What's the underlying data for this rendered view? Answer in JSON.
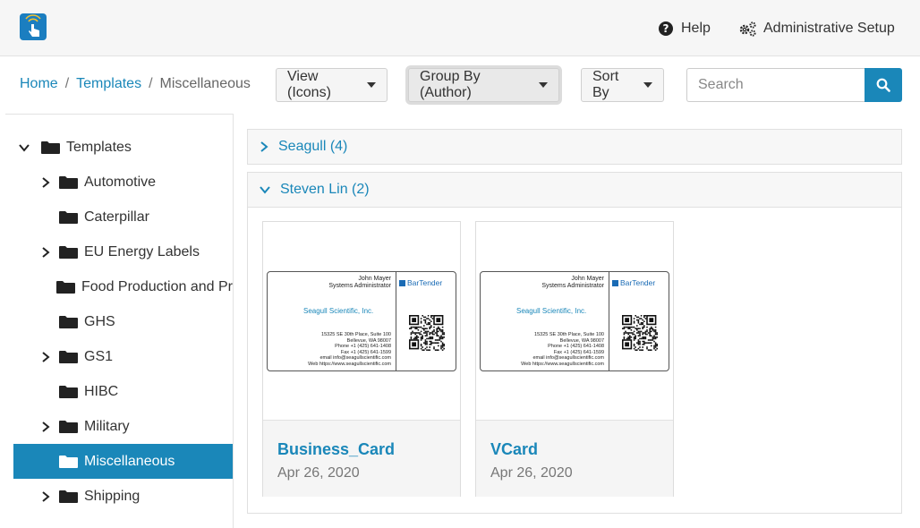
{
  "header": {
    "help_label": "Help",
    "admin_label": "Administrative Setup"
  },
  "breadcrumb": {
    "home": "Home",
    "templates": "Templates",
    "current": "Miscellaneous"
  },
  "toolbar": {
    "view_label": "View (Icons)",
    "group_label": "Group By (Author)",
    "sort_label": "Sort By",
    "search_placeholder": "Search"
  },
  "tree": {
    "root": "Templates",
    "items": [
      {
        "label": "Automotive",
        "expandable": true
      },
      {
        "label": "Caterpillar",
        "expandable": false
      },
      {
        "label": "EU Energy Labels",
        "expandable": true
      },
      {
        "label": "Food Production and Pr",
        "expandable": false
      },
      {
        "label": "GHS",
        "expandable": false
      },
      {
        "label": "GS1",
        "expandable": true
      },
      {
        "label": "HIBC",
        "expandable": false
      },
      {
        "label": "Military",
        "expandable": true
      },
      {
        "label": "Miscellaneous",
        "expandable": false,
        "selected": true
      },
      {
        "label": "Shipping",
        "expandable": true
      }
    ]
  },
  "groups": [
    {
      "label": "Seagull (4)",
      "expanded": false
    },
    {
      "label": "Steven Lin (2)",
      "expanded": true
    }
  ],
  "cards": [
    {
      "name": "Business_Card",
      "date": "Apr 26, 2020"
    },
    {
      "name": "VCard",
      "date": "Apr 26, 2020"
    }
  ],
  "business_card": {
    "person": "John Mayer",
    "role": "Systems Administrator",
    "company": "Seagull Scientific, Inc.",
    "brand": "BarTender",
    "address1": "15325 SE 30th Place, Suite 100",
    "address2": "Bellevue, WA 98007",
    "phone": "Phone +1 (425) 641-1408",
    "fax": "Fax +1 (425) 641-1599",
    "email": "email info@seagullscientific.com",
    "web": "Web https://www.seagullscientific.com"
  },
  "colors": {
    "accent": "#1a87b9",
    "selected_bg": "#1a87b9",
    "topbar_bg": "#f6f6f6"
  }
}
